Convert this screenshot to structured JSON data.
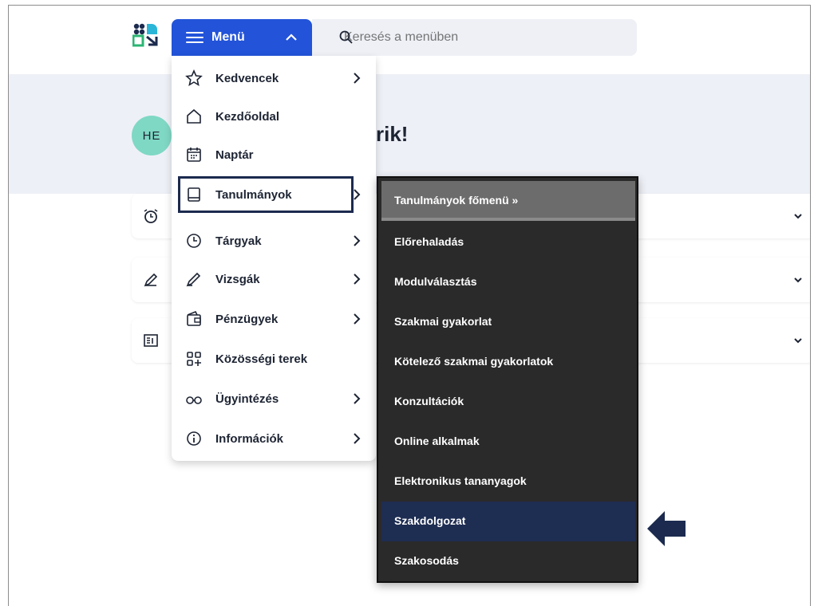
{
  "header": {
    "menu_label": "Menü",
    "search_placeholder": "Keresés a menüben"
  },
  "user": {
    "initials": "HE",
    "greeting_fragment": "rik!"
  },
  "menu": {
    "items": [
      {
        "label": "Kedvencek",
        "icon": "star-icon",
        "has_submenu": true
      },
      {
        "label": "Kezdőoldal",
        "icon": "home-icon",
        "has_submenu": false
      },
      {
        "label": "Naptár",
        "icon": "calendar-icon",
        "has_submenu": false
      },
      {
        "label": "Tanulmányok",
        "icon": "book-icon",
        "has_submenu": true,
        "active": true
      },
      {
        "label": "Tárgyak",
        "icon": "clock-icon",
        "has_submenu": true
      },
      {
        "label": "Vizsgák",
        "icon": "pen-icon",
        "has_submenu": true
      },
      {
        "label": "Pénzügyek",
        "icon": "wallet-icon",
        "has_submenu": true
      },
      {
        "label": "Közösségi terek",
        "icon": "grid-plus-icon",
        "has_submenu": false
      },
      {
        "label": "Ügyintézés",
        "icon": "glasses-icon",
        "has_submenu": true
      },
      {
        "label": "Információk",
        "icon": "info-icon",
        "has_submenu": true
      }
    ]
  },
  "submenu": {
    "header": "Tanulmányok főmenü »",
    "items": [
      {
        "label": "Előrehaladás"
      },
      {
        "label": "Modulválasztás"
      },
      {
        "label": "Szakmai gyakorlat"
      },
      {
        "label": "Kötelező szakmai gyakorlatok"
      },
      {
        "label": "Konzultációk"
      },
      {
        "label": "Online alkalmak"
      },
      {
        "label": "Elektronikus tananyagok"
      },
      {
        "label": "Szakdolgozat",
        "highlighted": true
      },
      {
        "label": "Szakosodás"
      }
    ]
  },
  "colors": {
    "menu_button": "#2253d9",
    "submenu_bg": "#2a2a2a",
    "highlight": "#1e2d52",
    "avatar": "#7fd8c4"
  }
}
